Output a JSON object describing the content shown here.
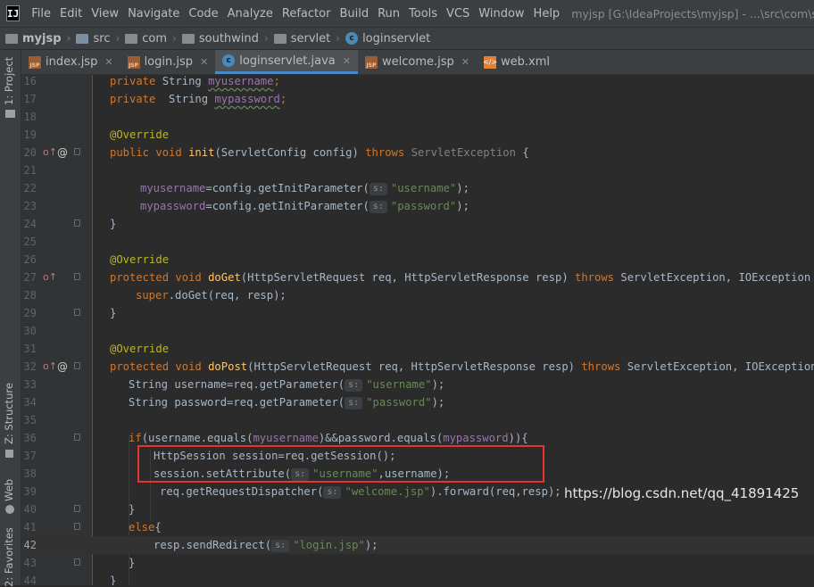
{
  "menubar": {
    "logo": "IJ",
    "items": [
      "File",
      "Edit",
      "View",
      "Navigate",
      "Code",
      "Analyze",
      "Refactor",
      "Build",
      "Run",
      "Tools",
      "VCS",
      "Window",
      "Help"
    ],
    "window_title": "myjsp [G:\\IdeaProjects\\myjsp] - ...\\src\\com\\southwi"
  },
  "breadcrumbs": {
    "project": "myjsp",
    "items": [
      "src",
      "com",
      "southwind",
      "servlet",
      "loginservlet"
    ]
  },
  "leftbar": {
    "project_tab": "1: Project",
    "structure_tab": "Z: Structure",
    "web_tab": "Web",
    "favorites_tab": "2: Favorites"
  },
  "tabs": [
    {
      "label": "index.jsp",
      "type": "jsp"
    },
    {
      "label": "login.jsp",
      "type": "jsp"
    },
    {
      "label": "loginservlet.java",
      "type": "java",
      "active": true
    },
    {
      "label": "welcome.jsp",
      "type": "jsp"
    },
    {
      "label": "web.xml",
      "type": "xml"
    }
  ],
  "hints": {
    "param": "s:"
  },
  "editor": {
    "line_numbers": [
      "16",
      "17",
      "18",
      "19",
      "20",
      "21",
      "22",
      "23",
      "24",
      "25",
      "26",
      "27",
      "28",
      "29",
      "30",
      "31",
      "32",
      "33",
      "34",
      "35",
      "36",
      "37",
      "38",
      "39",
      "40",
      "41",
      "42",
      "43",
      "44"
    ],
    "current_line": "42",
    "code": {
      "l16": {
        "kw": "private",
        "type": "String",
        "field": "myusername",
        "end": ";"
      },
      "l17": {
        "kw": "private",
        "type": " String",
        "field": "mypassword",
        "end": ";"
      },
      "l19": "@Override",
      "l20": {
        "kw1": "public",
        "kw2": "void",
        "name": "init",
        "sig": "(ServletConfig config) ",
        "throws": "throws",
        "exc": "ServletException",
        "end": " {"
      },
      "l22": {
        "field": "myusername",
        "mid": "=config.getInitParameter(",
        "str": "\"username\"",
        "end": ");"
      },
      "l23": {
        "field": "mypassword",
        "mid": "=config.getInitParameter(",
        "str": "\"password\"",
        "end": ");"
      },
      "l24": "}",
      "l26": "@Override",
      "l27": {
        "kw1": "protected",
        "kw2": "void",
        "name": "doGet",
        "sig": "(HttpServletRequest req, HttpServletResponse resp) ",
        "throws": "throws",
        "exc": "ServletException, IOException {"
      },
      "l28": {
        "kw": "super",
        "rest": ".doGet(req, resp);"
      },
      "l29": "}",
      "l31": "@Override",
      "l32": {
        "kw1": "protected",
        "kw2": "void",
        "name": "doPost",
        "sig": "(HttpServletRequest req, HttpServletResponse resp) ",
        "throws": "throws",
        "exc": "ServletException, IOException {"
      },
      "l33": {
        "pre": "String username=req.getParameter(",
        "str": "\"username\"",
        "end": ");"
      },
      "l34": {
        "pre": "String password=req.getParameter(",
        "str": "\"password\"",
        "end": ");"
      },
      "l36": {
        "kw": "if",
        "a": "(username.equals(",
        "f1": "myusername",
        "b": ")&&password.equals(",
        "f2": "mypassword",
        "c": ")){"
      },
      "l37": "HttpSession session=req.getSession();",
      "l38": {
        "pre": "session.setAttribute(",
        "str": "\"username\"",
        "end": ",username);"
      },
      "l39": {
        "pre": "req.getRequestDispatcher(",
        "str": "\"welcome.jsp\"",
        "end": ").forward(req,resp);"
      },
      "l40": "}",
      "l41": {
        "kw": "else",
        "end": "{"
      },
      "l42": {
        "pre": "resp.sendRedirect(",
        "str": "\"login.jsp\"",
        "end": ");"
      },
      "l43": "}",
      "l44": "}"
    }
  },
  "watermark": "https://blog.csdn.net/qq_41891425",
  "colors": {
    "background": "#2b2b2b",
    "keyword": "#cc7832",
    "annotation": "#bbb529",
    "field": "#9876aa",
    "method": "#ffc66d",
    "string": "#6a8759",
    "highlight_box": "#e8332f"
  }
}
